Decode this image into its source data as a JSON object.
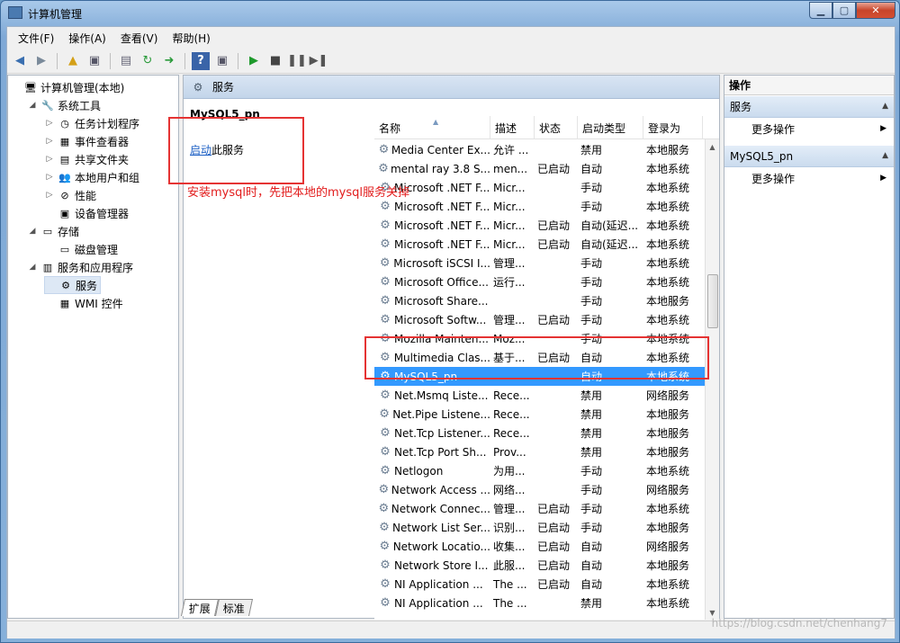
{
  "window": {
    "title": "计算机管理",
    "min": "▁",
    "max": "▢",
    "close": "✕"
  },
  "menu": [
    "文件(F)",
    "操作(A)",
    "查看(V)",
    "帮助(H)"
  ],
  "tree": [
    {
      "label": "计算机管理(本地)",
      "icon": "computer-icon",
      "exp": "",
      "level": 0
    },
    {
      "label": "系统工具",
      "icon": "tools-icon",
      "exp": "◢",
      "level": 1
    },
    {
      "label": "任务计划程序",
      "icon": "clock-icon",
      "exp": "▷",
      "level": 2
    },
    {
      "label": "事件查看器",
      "icon": "event-viewer-icon",
      "exp": "▷",
      "level": 2
    },
    {
      "label": "共享文件夹",
      "icon": "shared-folder-icon",
      "exp": "▷",
      "level": 2
    },
    {
      "label": "本地用户和组",
      "icon": "users-icon",
      "exp": "▷",
      "level": 2
    },
    {
      "label": "性能",
      "icon": "performance-icon",
      "exp": "▷",
      "level": 2
    },
    {
      "label": "设备管理器",
      "icon": "device-manager-icon",
      "exp": "",
      "level": 2
    },
    {
      "label": "存储",
      "icon": "storage-icon",
      "exp": "◢",
      "level": 1
    },
    {
      "label": "磁盘管理",
      "icon": "disk-icon",
      "exp": "",
      "level": 2
    },
    {
      "label": "服务和应用程序",
      "icon": "services-apps-icon",
      "exp": "◢",
      "level": 1
    },
    {
      "label": "服务",
      "icon": "gear-icon",
      "exp": "",
      "level": 2,
      "selected": true
    },
    {
      "label": "WMI 控件",
      "icon": "wmi-icon",
      "exp": "",
      "level": 2
    }
  ],
  "middle": {
    "header": "服务",
    "service_name": "MySQL5_pn",
    "start_link": "启动",
    "start_suffix": "此服务",
    "annotation": "安装mysql时，先把本地的mysql服务关掉",
    "columns": [
      "名称",
      "描述",
      "状态",
      "启动类型",
      "登录为"
    ],
    "rows": [
      [
        "Media Center Ex...",
        "允许 ...",
        "",
        "禁用",
        "本地服务"
      ],
      [
        "mental ray 3.8 S...",
        "men...",
        "已启动",
        "自动",
        "本地系统"
      ],
      [
        "Microsoft .NET F...",
        "Micr...",
        "",
        "手动",
        "本地系统"
      ],
      [
        "Microsoft .NET F...",
        "Micr...",
        "",
        "手动",
        "本地系统"
      ],
      [
        "Microsoft .NET F...",
        "Micr...",
        "已启动",
        "自动(延迟...",
        "本地系统"
      ],
      [
        "Microsoft .NET F...",
        "Micr...",
        "已启动",
        "自动(延迟...",
        "本地系统"
      ],
      [
        "Microsoft iSCSI I...",
        "管理...",
        "",
        "手动",
        "本地系统"
      ],
      [
        "Microsoft Office...",
        "运行...",
        "",
        "手动",
        "本地系统"
      ],
      [
        "Microsoft Share...",
        "",
        "",
        "手动",
        "本地服务"
      ],
      [
        "Microsoft Softw...",
        "管理...",
        "已启动",
        "手动",
        "本地系统"
      ],
      [
        "Mozilla Mainten...",
        "Moz...",
        "",
        "手动",
        "本地系统"
      ],
      [
        "Multimedia Clas...",
        "基于...",
        "已启动",
        "自动",
        "本地系统"
      ],
      [
        "MySQL5_pn",
        "",
        "",
        "自动",
        "本地系统"
      ],
      [
        "Net.Msmq Liste...",
        "Rece...",
        "",
        "禁用",
        "网络服务"
      ],
      [
        "Net.Pipe Listene...",
        "Rece...",
        "",
        "禁用",
        "本地服务"
      ],
      [
        "Net.Tcp Listener...",
        "Rece...",
        "",
        "禁用",
        "本地服务"
      ],
      [
        "Net.Tcp Port Sh...",
        "Prov...",
        "",
        "禁用",
        "本地服务"
      ],
      [
        "Netlogon",
        "为用...",
        "",
        "手动",
        "本地系统"
      ],
      [
        "Network Access ...",
        "网络...",
        "",
        "手动",
        "网络服务"
      ],
      [
        "Network Connec...",
        "管理...",
        "已启动",
        "手动",
        "本地系统"
      ],
      [
        "Network List Ser...",
        "识别...",
        "已启动",
        "手动",
        "本地服务"
      ],
      [
        "Network Locatio...",
        "收集...",
        "已启动",
        "自动",
        "网络服务"
      ],
      [
        "Network Store I...",
        "此服...",
        "已启动",
        "自动",
        "本地服务"
      ],
      [
        "NI Application ...",
        "The ...",
        "已启动",
        "自动",
        "本地系统"
      ],
      [
        "NI Application ...",
        "The ...",
        "",
        "禁用",
        "本地系统"
      ]
    ],
    "selected_index": 12,
    "tabs": [
      "扩展",
      "标准"
    ]
  },
  "actions": {
    "header": "操作",
    "section1": "服务",
    "section1_item": "更多操作",
    "section2": "MySQL5_pn",
    "section2_item": "更多操作"
  },
  "watermark": "https://blog.csdn.net/chenhang7",
  "colors": {
    "selection": "#3399ff",
    "annotation_red": "#e21c1c"
  }
}
